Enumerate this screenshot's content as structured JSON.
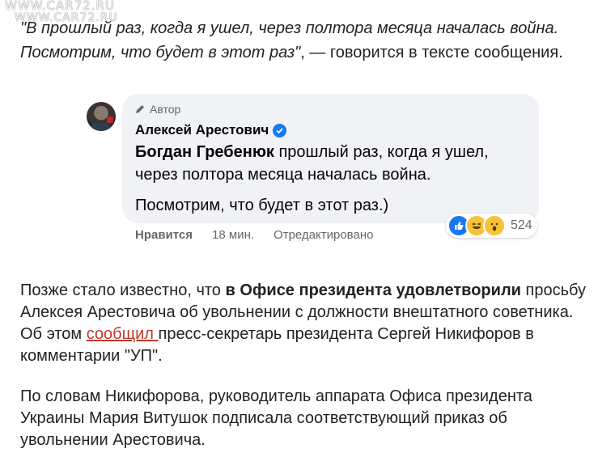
{
  "watermark": "WWW.CAR72.RU",
  "quote": {
    "line1": "\"В прошлый раз, когда я ушел, через полтора месяца началась война.",
    "line2_italic": "Посмотрим, что будет в этот раз\"",
    "line2_rest": ", — говорится в тексте сообщения."
  },
  "comment": {
    "author_tag": "Автор",
    "author_name": "Алексей Арестович",
    "mention": "Богдан Гребенюк",
    "text1": " прошлый раз, когда я ушел, через полтора месяца началась война.",
    "text2": "Посмотрим, что будет в этот раз.)",
    "reaction_count": "524",
    "like_label": "Нравится",
    "time": "18 мин.",
    "edited": "Отредактировано"
  },
  "para1": {
    "t1": "Позже стало известно, что ",
    "bold": "в Офисе президента удовлетворили",
    "t2": " просьбу Алексея Арестовича об увольнении с должности внештатного советника. Об этом ",
    "link": "сообщил ",
    "t3": "пресс-секретарь президента Сергей Никифоров в комментарии \"УП\"."
  },
  "para2": "По словам Никифорова, руководитель аппарата Офиса президента Украины Мария Витушок подписала соответствующий приказ об увольнении Арестовича.",
  "colors": {
    "link": "#c0392b",
    "bubble": "#f0f2f5",
    "verified": "#1877f2"
  },
  "icons": [
    "pen-icon",
    "verified-icon",
    "like-reaction-icon",
    "haha-reaction-icon",
    "wow-reaction-icon"
  ]
}
